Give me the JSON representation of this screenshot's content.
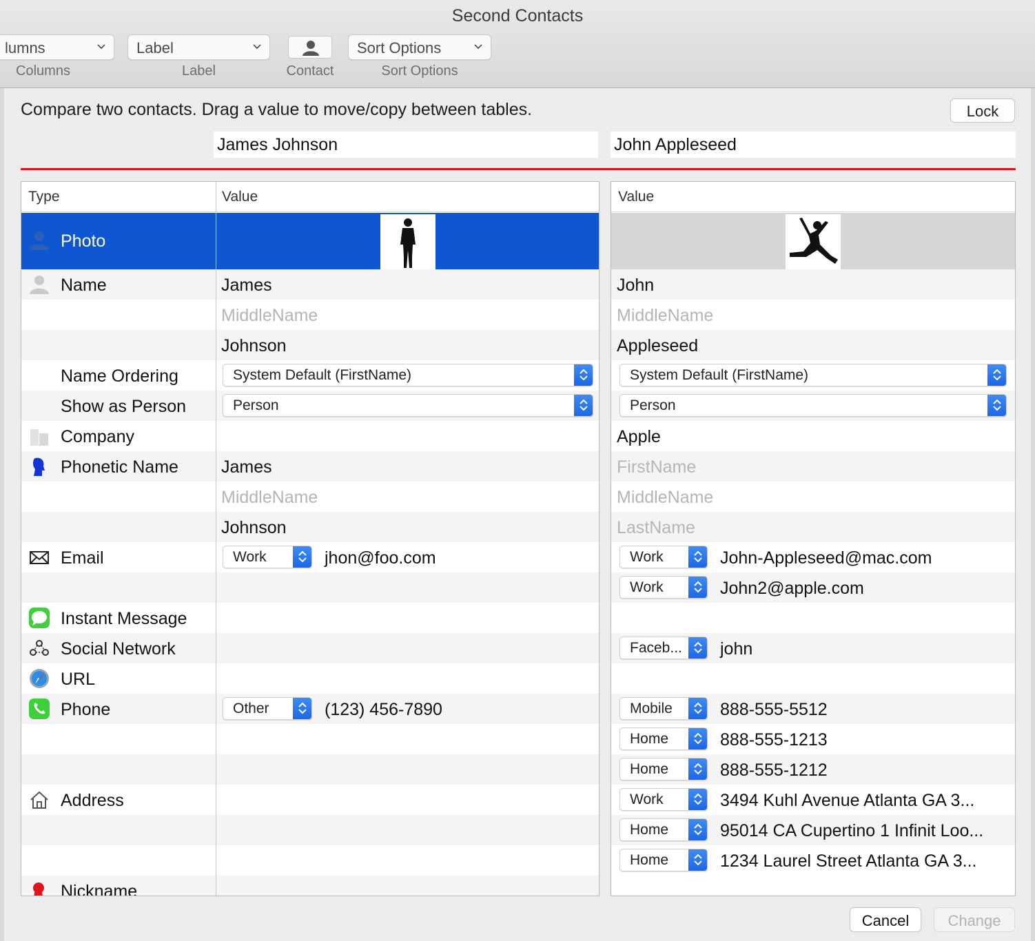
{
  "window": {
    "title": "Second Contacts"
  },
  "toolbar": {
    "columns_value": "lumns",
    "columns_caption": "Columns",
    "label_value": "Label",
    "label_caption": "Label",
    "contact_caption": "Contact",
    "sort_value": "Sort Options",
    "sort_caption": "Sort Options"
  },
  "header": {
    "instruction": "Compare two contacts. Drag a value to move/copy between tables.",
    "lock_label": "Lock",
    "left_name": "James Johnson",
    "right_name": "John Appleseed"
  },
  "left_table": {
    "col_type": "Type",
    "col_value": "Value",
    "types": {
      "photo": "Photo",
      "name": "Name",
      "name_ordering": "Name Ordering",
      "show_as_person": "Show as Person",
      "company": "Company",
      "phonetic_name": "Phonetic Name",
      "email": "Email",
      "instant_message": "Instant Message",
      "social_network": "Social Network",
      "url": "URL",
      "phone": "Phone",
      "address": "Address",
      "nickname": "Nickname"
    },
    "values": {
      "first": "James",
      "middle_ph": "MiddleName",
      "last": "Johnson",
      "name_ordering": "System Default (FirstName)",
      "show_as": "Person",
      "ph_first": "James",
      "ph_middle_ph": "MiddleName",
      "ph_last": "Johnson",
      "email_label": "Work",
      "email": "jhon@foo.com",
      "phone_label": "Other",
      "phone": "(123) 456-7890"
    }
  },
  "right_table": {
    "col_value": "Value",
    "values": {
      "first": "John",
      "middle_ph": "MiddleName",
      "last": "Appleseed",
      "name_ordering": "System Default (FirstName)",
      "show_as": "Person",
      "company": "Apple",
      "ph_first_ph": "FirstName",
      "ph_middle_ph": "MiddleName",
      "ph_last_ph": "LastName",
      "email1_label": "Work",
      "email1": "John-Appleseed@mac.com",
      "email2_label": "Work",
      "email2": "John2@apple.com",
      "social_label": "Faceb...",
      "social": "john",
      "phone1_label": "Mobile",
      "phone1": "888-555-5512",
      "phone2_label": "Home",
      "phone2": "888-555-1213",
      "phone3_label": "Home",
      "phone3": "888-555-1212",
      "addr1_label": "Work",
      "addr1": "3494 Kuhl Avenue Atlanta GA 3...",
      "addr2_label": "Home",
      "addr2": "95014 CA Cupertino 1 Infinit Loo...",
      "addr3_label": "Home",
      "addr3": "1234 Laurel Street Atlanta GA 3..."
    }
  },
  "footer": {
    "cancel_label": "Cancel",
    "change_label": "Change"
  },
  "colors": {
    "accent": "#0e57d1",
    "divider": "#e0151b",
    "stepper": "#1a67e6"
  }
}
